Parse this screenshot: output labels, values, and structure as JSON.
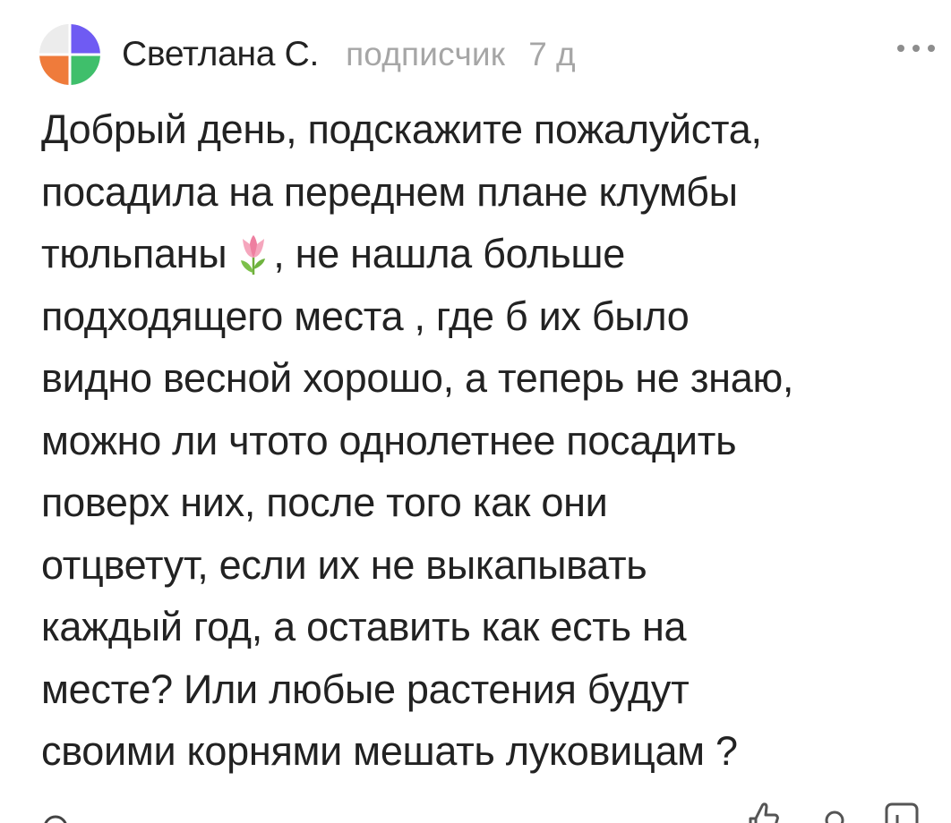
{
  "comment": {
    "author": "Светлана С.",
    "role": "подписчик",
    "time": "7 д",
    "avatar_colors": [
      "#6f5bf3",
      "#ef7b3b",
      "#3fbf6b",
      "#e6e6e6"
    ],
    "emoji_icon": "tulip-emoji",
    "more_icon": "more-horizontal-icon",
    "lines": {
      "l1": "Добрый день, подскажите пожалуйста,",
      "l2": "посадила на переднем плане клумбы",
      "l3a": "тюльпаны",
      "l3b": ", не нашла больше",
      "l4": "подходящего места , где б их было",
      "l5": "видно весной хорошо, а теперь не знаю,",
      "l6": "можно ли чтото однолетнее посадить",
      "l7": "поверх них, после того как они",
      "l8": "отцветут, если их не выкапывать",
      "l9": "каждый год, а оставить как есть на",
      "l10": "месте? Или любые растения будут",
      "l11": "своими корнями мешать луковицам ?"
    }
  },
  "footer": {
    "icons": [
      "like-icon",
      "dislike-icon",
      "reply-icon"
    ]
  }
}
